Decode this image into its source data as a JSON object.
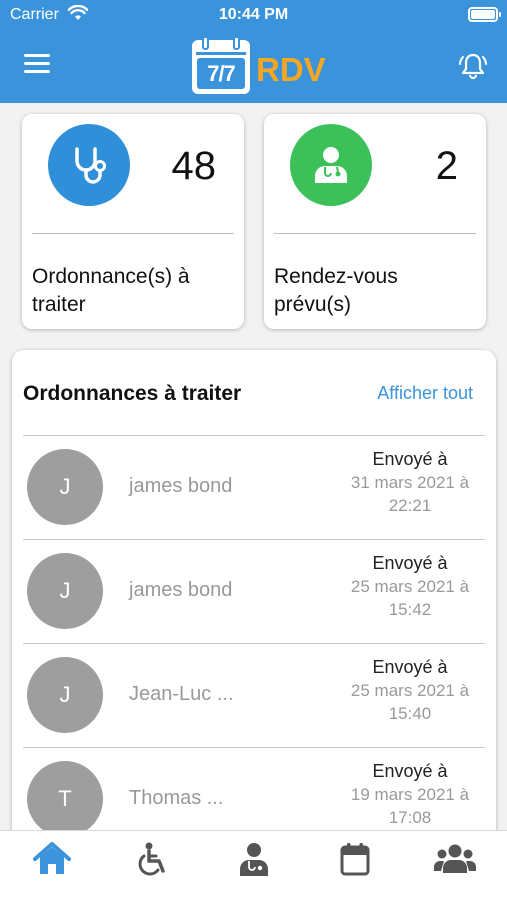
{
  "status_bar": {
    "carrier": "Carrier",
    "time": "10:44 PM"
  },
  "header": {
    "logo_number": "7/7",
    "logo_text": "RDV"
  },
  "stats": [
    {
      "count": "48",
      "label": "Ordonnance(s) à traiter",
      "color": "#2f8fd8",
      "icon": "stethoscope-icon"
    },
    {
      "count": "2",
      "label": "Rendez-vous prévu(s)",
      "color": "#3cc15a",
      "icon": "doctor-icon"
    }
  ],
  "prescriptions": {
    "title": "Ordonnances à traiter",
    "see_all": "Afficher tout",
    "rows": [
      {
        "initial": "J",
        "name": "james bond",
        "sent_label": "Envoyé à",
        "date_line1": "31 mars 2021 à",
        "date_line2": "22:21"
      },
      {
        "initial": "J",
        "name": "james bond",
        "sent_label": "Envoyé à",
        "date_line1": "25 mars 2021 à",
        "date_line2": "15:42"
      },
      {
        "initial": "J",
        "name": "Jean-Luc ...",
        "sent_label": "Envoyé à",
        "date_line1": "25 mars 2021 à",
        "date_line2": "15:40"
      },
      {
        "initial": "T",
        "name": "Thomas ...",
        "sent_label": "Envoyé à",
        "date_line1": "19 mars 2021 à",
        "date_line2": "17:08"
      }
    ]
  },
  "tabbar": {
    "active_color": "#3a93db",
    "inactive_color": "#555555",
    "tabs": [
      {
        "icon": "home-icon",
        "active": true
      },
      {
        "icon": "wheelchair-icon",
        "active": false
      },
      {
        "icon": "doctor-icon",
        "active": false
      },
      {
        "icon": "calendar-icon",
        "active": false
      },
      {
        "icon": "users-icon",
        "active": false
      }
    ]
  }
}
